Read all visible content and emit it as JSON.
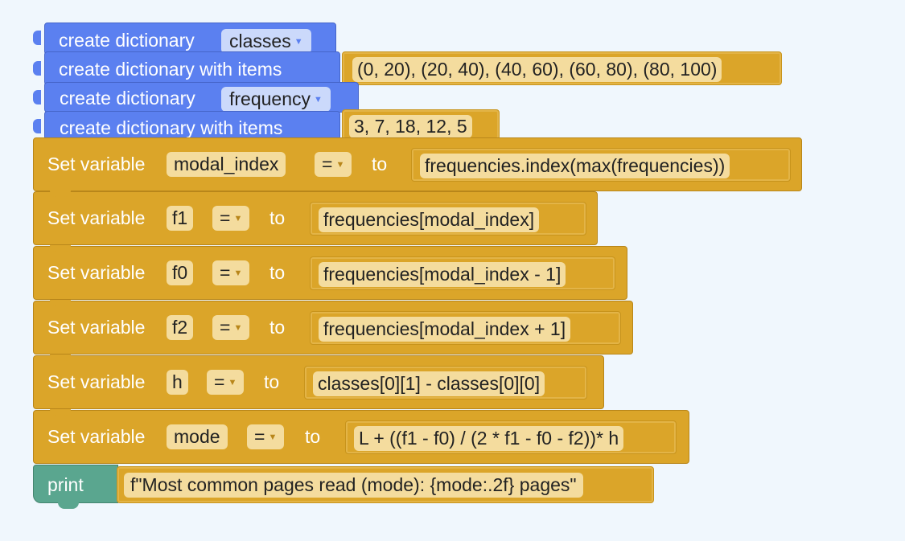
{
  "blocks": {
    "b1": {
      "label": "create dictionary",
      "dropdown": "classes"
    },
    "b2": {
      "label": "create dictionary with items",
      "value": "(0, 20), (20, 40), (40, 60), (60, 80), (80, 100)"
    },
    "b3": {
      "label": "create dictionary",
      "dropdown": "frequency"
    },
    "b4": {
      "label": "create dictionary with items",
      "value": "3, 7, 18, 12, 5"
    },
    "sets": [
      {
        "set_label": "Set variable",
        "var": "modal_index",
        "op": "=",
        "to_label": "to",
        "expr": "frequencies.index(max(frequencies))"
      },
      {
        "set_label": "Set variable",
        "var": "f1",
        "op": "=",
        "to_label": "to",
        "expr": "frequencies[modal_index]"
      },
      {
        "set_label": "Set variable",
        "var": "f0",
        "op": "=",
        "to_label": "to",
        "expr": "frequencies[modal_index - 1]"
      },
      {
        "set_label": "Set variable",
        "var": "f2",
        "op": "=",
        "to_label": "to",
        "expr": "frequencies[modal_index + 1]"
      },
      {
        "set_label": "Set variable",
        "var": "h",
        "op": "=",
        "to_label": "to",
        "expr": "classes[0][1] - classes[0][0]"
      },
      {
        "set_label": "Set variable",
        "var": "mode",
        "op": "=",
        "to_label": "to",
        "expr": "L + ((f1 - f0) / (2 * f1 - f0 - f2))* h"
      }
    ],
    "print": {
      "label": "print",
      "value": "f\"Most common pages read (mode): {mode:.2f} pages\""
    }
  },
  "icons": {
    "dropdown": "dropdown-arrow-icon",
    "arrow_char": "▼"
  },
  "colors": {
    "background": "#f0f7fd",
    "dictionary_block": "#5b80f0",
    "variable_block": "#dba529",
    "print_block": "#5aa68f",
    "field": "#f4dc9e"
  }
}
